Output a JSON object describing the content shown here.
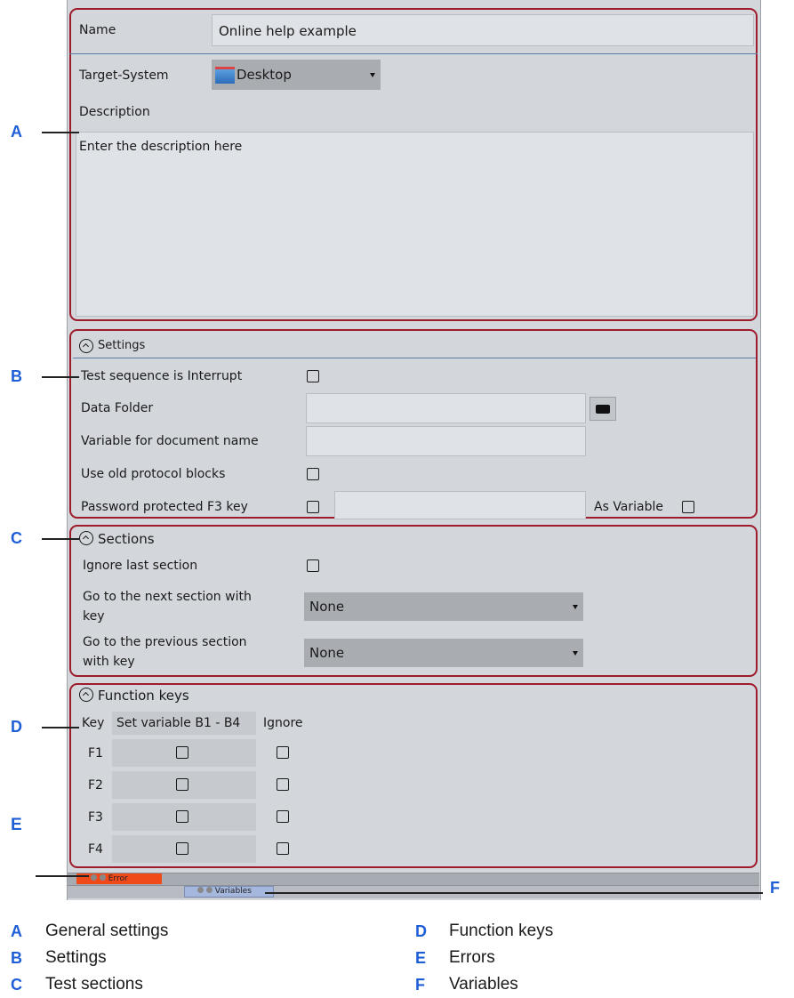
{
  "general": {
    "name_label": "Name",
    "name_value": "Online help example",
    "target_label": "Target-System",
    "target_value": "Desktop",
    "description_label": "Description",
    "description_value": "Enter the description here"
  },
  "settings": {
    "header": "Settings",
    "test_interrupt_label": "Test sequence is Interrupt",
    "data_folder_label": "Data Folder",
    "variable_doc_label": "Variable for document name",
    "old_protocol_label": "Use old protocol blocks",
    "password_f3_label": "Password protected F3 key",
    "as_variable_label": "As Variable"
  },
  "sections": {
    "header": "Sections",
    "ignore_last_label": "Ignore last section",
    "next_label_1": "Go to the next section with",
    "next_label_2": "key",
    "next_value": "None",
    "prev_label_1": "Go to the previous section",
    "prev_label_2": "with key",
    "prev_value": "None"
  },
  "function_keys": {
    "header": "Function keys",
    "col_key": "Key",
    "col_set": "Set variable B1 - B4",
    "col_ignore": "Ignore",
    "rows": [
      "F1",
      "F2",
      "F3",
      "F4"
    ]
  },
  "bottom": {
    "error_tab": "Error",
    "variables_tab": "Variables"
  },
  "callouts": [
    "A",
    "B",
    "C",
    "D",
    "E",
    "F"
  ],
  "legend": [
    {
      "letter": "A",
      "text": "General settings"
    },
    {
      "letter": "B",
      "text": "Settings"
    },
    {
      "letter": "C",
      "text": "Test sections"
    },
    {
      "letter": "D",
      "text": "Function keys"
    },
    {
      "letter": "E",
      "text": "Errors"
    },
    {
      "letter": "F",
      "text": "Variables"
    }
  ],
  "colors": {
    "callout": "#1f5fd6",
    "highlight_box": "#9e1b2c",
    "error_tab": "#f04a1a",
    "variables_tab": "#a5b7dc"
  }
}
